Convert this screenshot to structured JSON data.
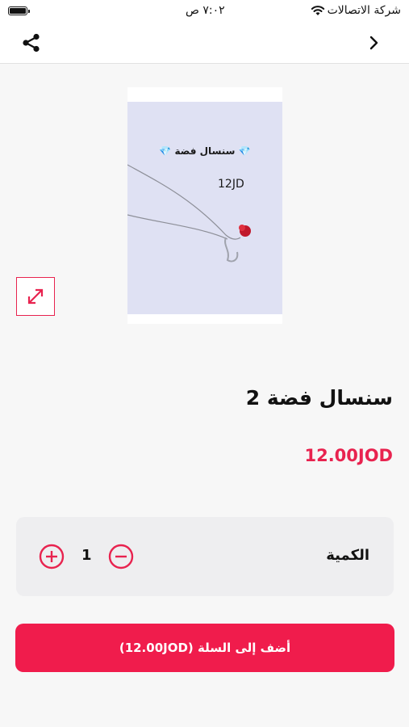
{
  "status_bar": {
    "carrier": "شركة الاتصالات",
    "time": "٧:٠٢ ص"
  },
  "nav": {
    "back_icon": "chevron-right-icon",
    "share_icon": "share-icon"
  },
  "product": {
    "image": {
      "caption": "💎 سنسال فضة 💎",
      "price_tag": "12JD"
    },
    "title": "سنسال فضة 2",
    "price": "12.00JOD"
  },
  "quantity": {
    "label": "الكمية",
    "value": "1"
  },
  "cart": {
    "button_label": "أضف إلى السلة (12.00JOD)"
  },
  "colors": {
    "accent": "#f01c4c",
    "card_bg": "#eeeef0",
    "page_bg": "#f7f7f7"
  }
}
